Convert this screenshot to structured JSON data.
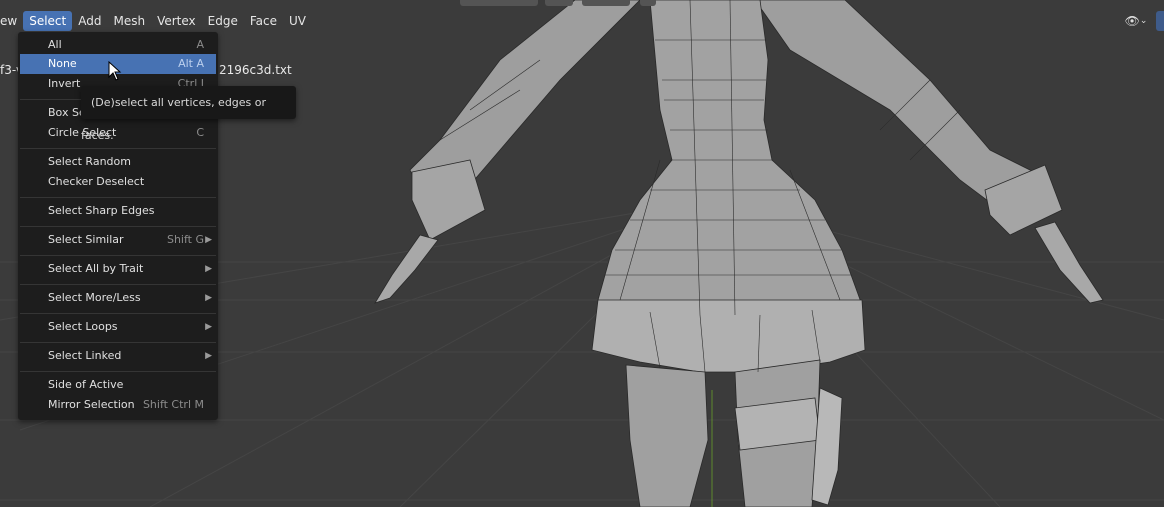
{
  "header": {
    "cut_label": "ew",
    "menus": [
      {
        "label": "Select",
        "active": true
      },
      {
        "label": "Add"
      },
      {
        "label": "Mesh"
      },
      {
        "label": "Vertex"
      },
      {
        "label": "Edge"
      },
      {
        "label": "Face"
      },
      {
        "label": "UV"
      }
    ]
  },
  "overlay": {
    "left_fragment": "f3-v",
    "file_fragment": "2196c3d.txt"
  },
  "select_menu": {
    "items": [
      {
        "label": "All",
        "shortcut": "A"
      },
      {
        "label": "None",
        "shortcut": "Alt A",
        "highlighted": true
      },
      {
        "label": "Invert",
        "shortcut": "Ctrl I"
      },
      {
        "label": "Box Select",
        "shortcut": ""
      },
      {
        "label": "Circle Select",
        "shortcut": "C"
      },
      {
        "label": "Select Random",
        "shortcut": ""
      },
      {
        "label": "Checker Deselect",
        "shortcut": ""
      },
      {
        "label": "Select Sharp Edges",
        "shortcut": ""
      },
      {
        "label": "Select Similar",
        "shortcut": "Shift G",
        "submenu": true
      },
      {
        "label": "Select All by Trait",
        "shortcut": "",
        "submenu": true
      },
      {
        "label": "Select More/Less",
        "shortcut": "",
        "submenu": true
      },
      {
        "label": "Select Loops",
        "shortcut": "",
        "submenu": true
      },
      {
        "label": "Select Linked",
        "shortcut": "",
        "submenu": true
      },
      {
        "label": "Side of Active",
        "shortcut": ""
      },
      {
        "label": "Mirror Selection",
        "shortcut": "Shift Ctrl M"
      }
    ],
    "submenu_arrow": "▶"
  },
  "tooltip": {
    "text": "(De)select all vertices, edges or faces."
  },
  "colors": {
    "accent": "#4772b3",
    "menu_bg": "#1d1d1d",
    "viewport_bg": "#3b3b3b"
  }
}
